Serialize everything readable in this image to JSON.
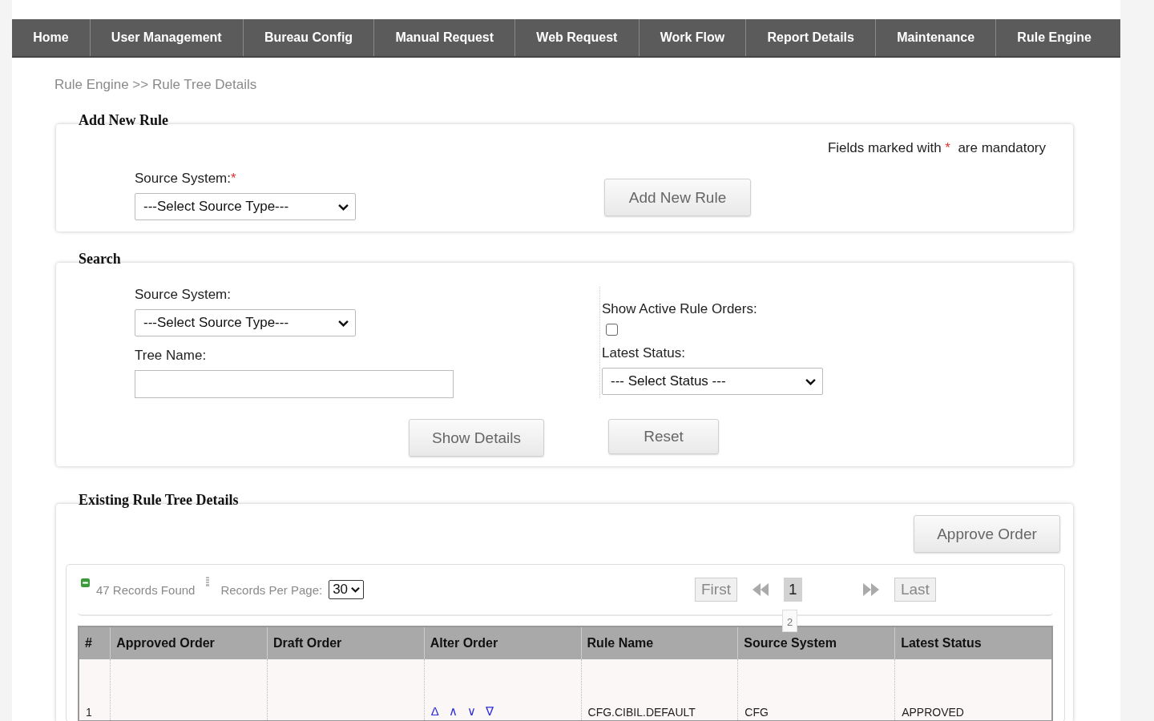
{
  "nav": [
    {
      "label": "Home"
    },
    {
      "label": "User Management"
    },
    {
      "label": "Bureau Config"
    },
    {
      "label": "Manual Request"
    },
    {
      "label": "Web Request"
    },
    {
      "label": "Work Flow"
    },
    {
      "label": "Report Details"
    },
    {
      "label": "Maintenance"
    },
    {
      "label": "Rule Engine"
    }
  ],
  "breadcrumb": "Rule Engine >> Rule Tree Details",
  "add_rule": {
    "legend": "Add New Rule",
    "note_before": "Fields marked with",
    "note_mark": "*",
    "note_after": "are mandatory",
    "source_label": "Source System:",
    "required_mark": "*",
    "source_select": "---Select Source Type---",
    "button": "Add New Rule"
  },
  "search": {
    "legend": "Search",
    "source_label": "Source System:",
    "source_select": "---Select Source Type---",
    "tree_label": "Tree Name:",
    "active_label": "Show Active Rule Orders:",
    "active_checked": false,
    "status_label": "Latest Status:",
    "status_select": "--- Select Status ---",
    "buttons": [
      "Show Details",
      "Reset"
    ]
  },
  "existing": {
    "legend": "Existing Rule Tree Details",
    "approve_button": "Approve Order",
    "records_found": "47 Records Found",
    "per_page_label": "Records Per Page:",
    "per_page": "30",
    "pagination": {
      "first": "First",
      "pages": [
        {
          "label": "1",
          "selected": true
        }
      ],
      "popup_page": "2",
      "last": "Last"
    },
    "table": {
      "columns": [
        "#",
        "Approved Order",
        "Draft Order",
        "Alter Order",
        "Rule Name",
        "Source System",
        "Latest Status"
      ],
      "rows": [
        {
          "number": "1",
          "alter_order": [
            "Δ",
            "∧",
            "∨",
            "∇"
          ],
          "rule_name": "CFG.CIBIL.DEFAULT",
          "source_system": "CFG",
          "latest_status": "APPROVED"
        }
      ]
    }
  }
}
